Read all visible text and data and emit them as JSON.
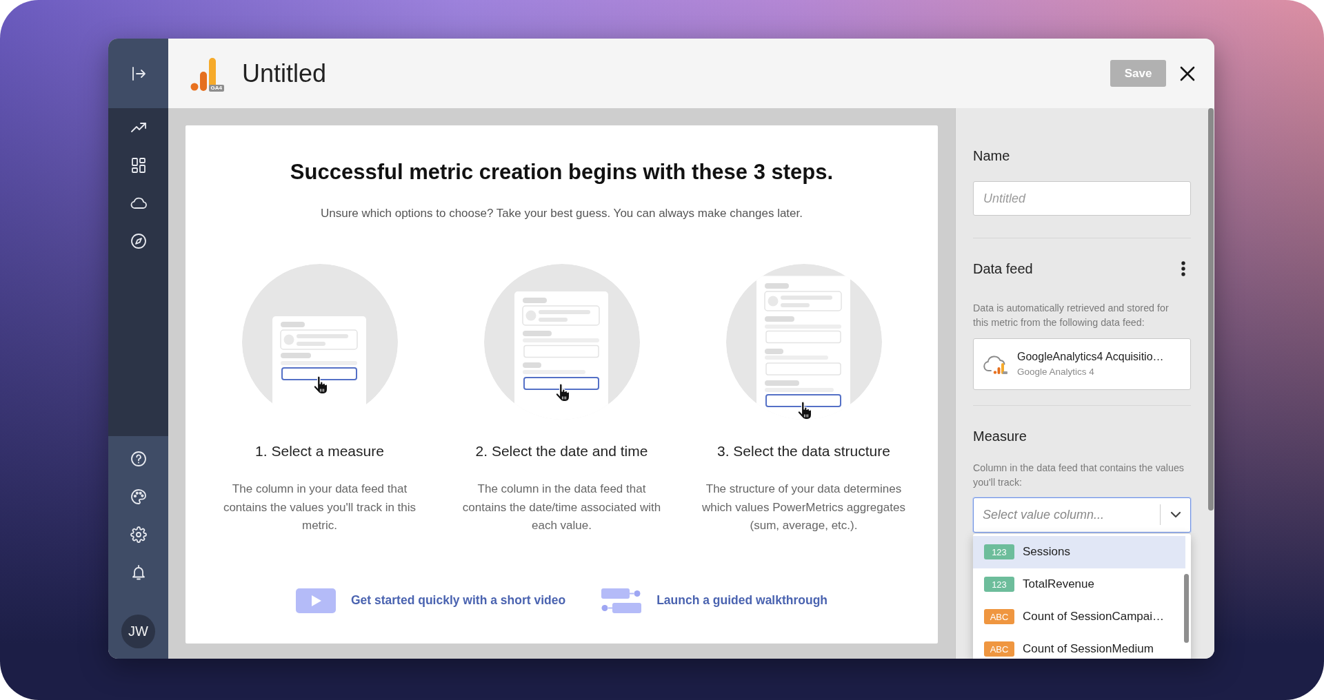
{
  "sidebar": {
    "avatar": "JW"
  },
  "header": {
    "logo_tag": "GA4",
    "title": "Untitled",
    "save_button": {
      "label": "Save",
      "disabled": true
    }
  },
  "intro": {
    "heading": "Successful metric creation begins with these 3 steps.",
    "subtitle": "Unsure which options to choose? Take your best guess. You can always make changes later.",
    "steps": [
      {
        "kind": "measure",
        "title": "1. Select a measure",
        "description": "The column in your data feed that contains the values you'll track in this metric."
      },
      {
        "kind": "datetime",
        "title": "2. Select the date and time",
        "description": "The column in the data feed that contains the date/time associated with each value."
      },
      {
        "kind": "structure",
        "title": "3. Select the data structure",
        "description": "The structure of your data determines which values PowerMetrics aggregates (sum, average, etc.)."
      }
    ],
    "links": [
      {
        "kind": "video",
        "label": "Get started quickly with a short video"
      },
      {
        "kind": "walkthrough",
        "label": "Launch a guided walkthrough"
      }
    ]
  },
  "settings": {
    "name": {
      "label": "Name",
      "placeholder": "Untitled"
    },
    "data_feed": {
      "label": "Data feed",
      "description": "Data is automatically retrieved and stored for this metric from the following data feed:",
      "feed": {
        "title": "GoogleAnalytics4 Acquisitio…",
        "source": "Google Analytics 4"
      }
    },
    "measure": {
      "label": "Measure",
      "description": "Column in the data feed that contains the values you'll track:",
      "select": {
        "placeholder": "Select value column...",
        "expanded": true,
        "options": [
          {
            "type_tag": "123",
            "color": "#6dbd9b",
            "label": "Sessions",
            "selected": true
          },
          {
            "type_tag": "123",
            "color": "#6dbd9b",
            "label": "TotalRevenue",
            "selected": false
          },
          {
            "type_tag": "ABC",
            "color": "#ef9640",
            "label": "Count of SessionCampai…",
            "selected": false
          },
          {
            "type_tag": "ABC",
            "color": "#ef9640",
            "label": "Count of SessionMedium",
            "selected": false
          }
        ]
      }
    }
  }
}
